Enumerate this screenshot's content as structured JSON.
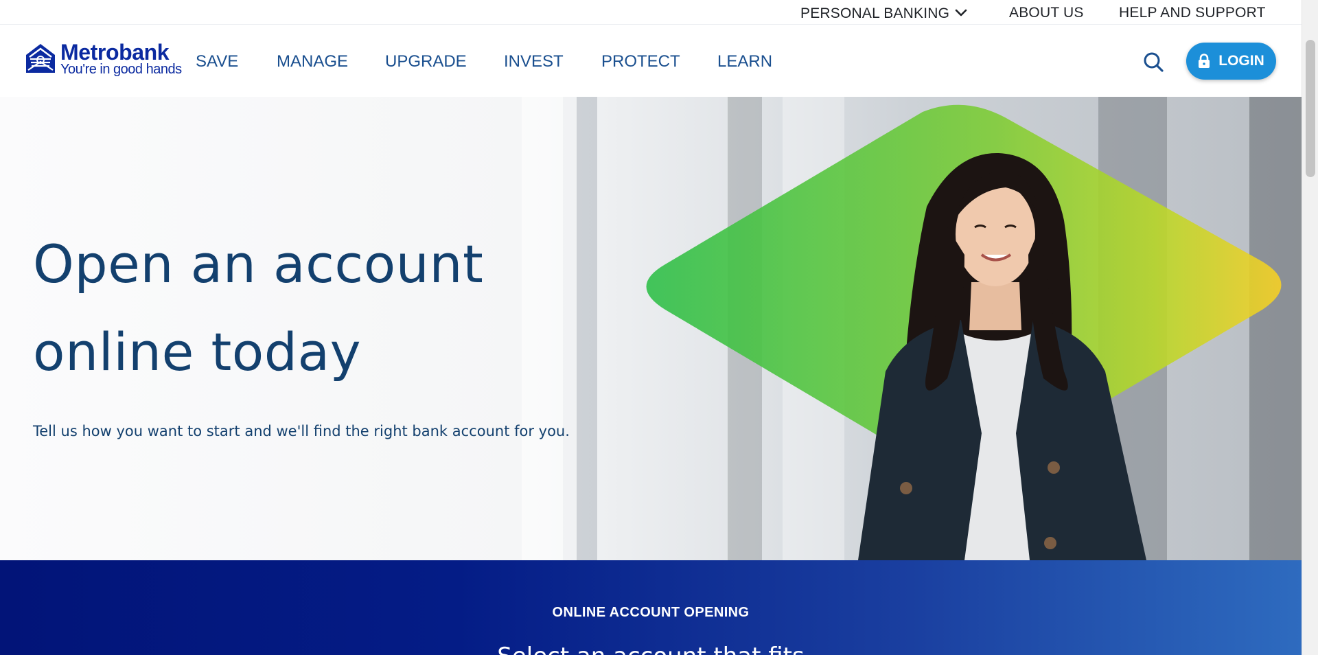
{
  "utility_nav": {
    "personal_banking": "PERSONAL BANKING",
    "about_us": "ABOUT US",
    "help_and_support": "HELP AND SUPPORT"
  },
  "brand": {
    "name": "Metrobank",
    "tagline": "You're in good hands",
    "color": "#0b2aa0"
  },
  "main_nav": {
    "items": [
      "SAVE",
      "MANAGE",
      "UPGRADE",
      "INVEST",
      "PROTECT",
      "LEARN"
    ]
  },
  "header_actions": {
    "search_icon": "search-icon",
    "login_label": "LOGIN",
    "login_icon": "lock-icon",
    "login_color": "#1c8fd9"
  },
  "hero": {
    "title_line1": "Open an account",
    "title_line2": "online today",
    "subtitle": "Tell us how you want to start and we'll find the right bank account for you.",
    "title_color": "#13406e",
    "diamond_colors": [
      "#2fbf4a",
      "#9fd32a",
      "#f6cf26"
    ]
  },
  "online_account_opening": {
    "eyebrow": "ONLINE ACCOUNT OPENING",
    "heading": "Select an account that fits",
    "band_colors": [
      "#021478",
      "#2e6bbf"
    ]
  }
}
